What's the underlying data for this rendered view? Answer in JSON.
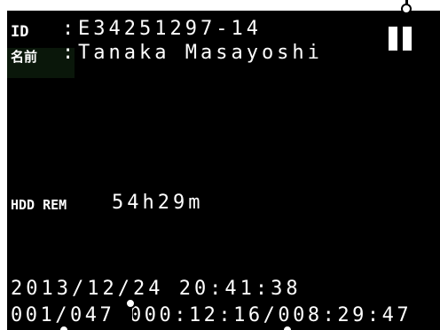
{
  "info": {
    "id_label": "ID",
    "id_sep": ":",
    "id_value": "E34251297-14",
    "name_label": "名前",
    "name_sep": ":",
    "name_value": "Tanaka Masayoshi"
  },
  "storage": {
    "label": "HDD REM",
    "value": "54h29m"
  },
  "status": {
    "datetime": "2013/12/24 20:41:38",
    "counter_line": "001/047 000:12:16/008:29:47"
  },
  "icons": {
    "state": "pause-icon"
  },
  "colors": {
    "screen_bg": "#000000",
    "text": "#ffffff",
    "frame": "#ffffff"
  }
}
